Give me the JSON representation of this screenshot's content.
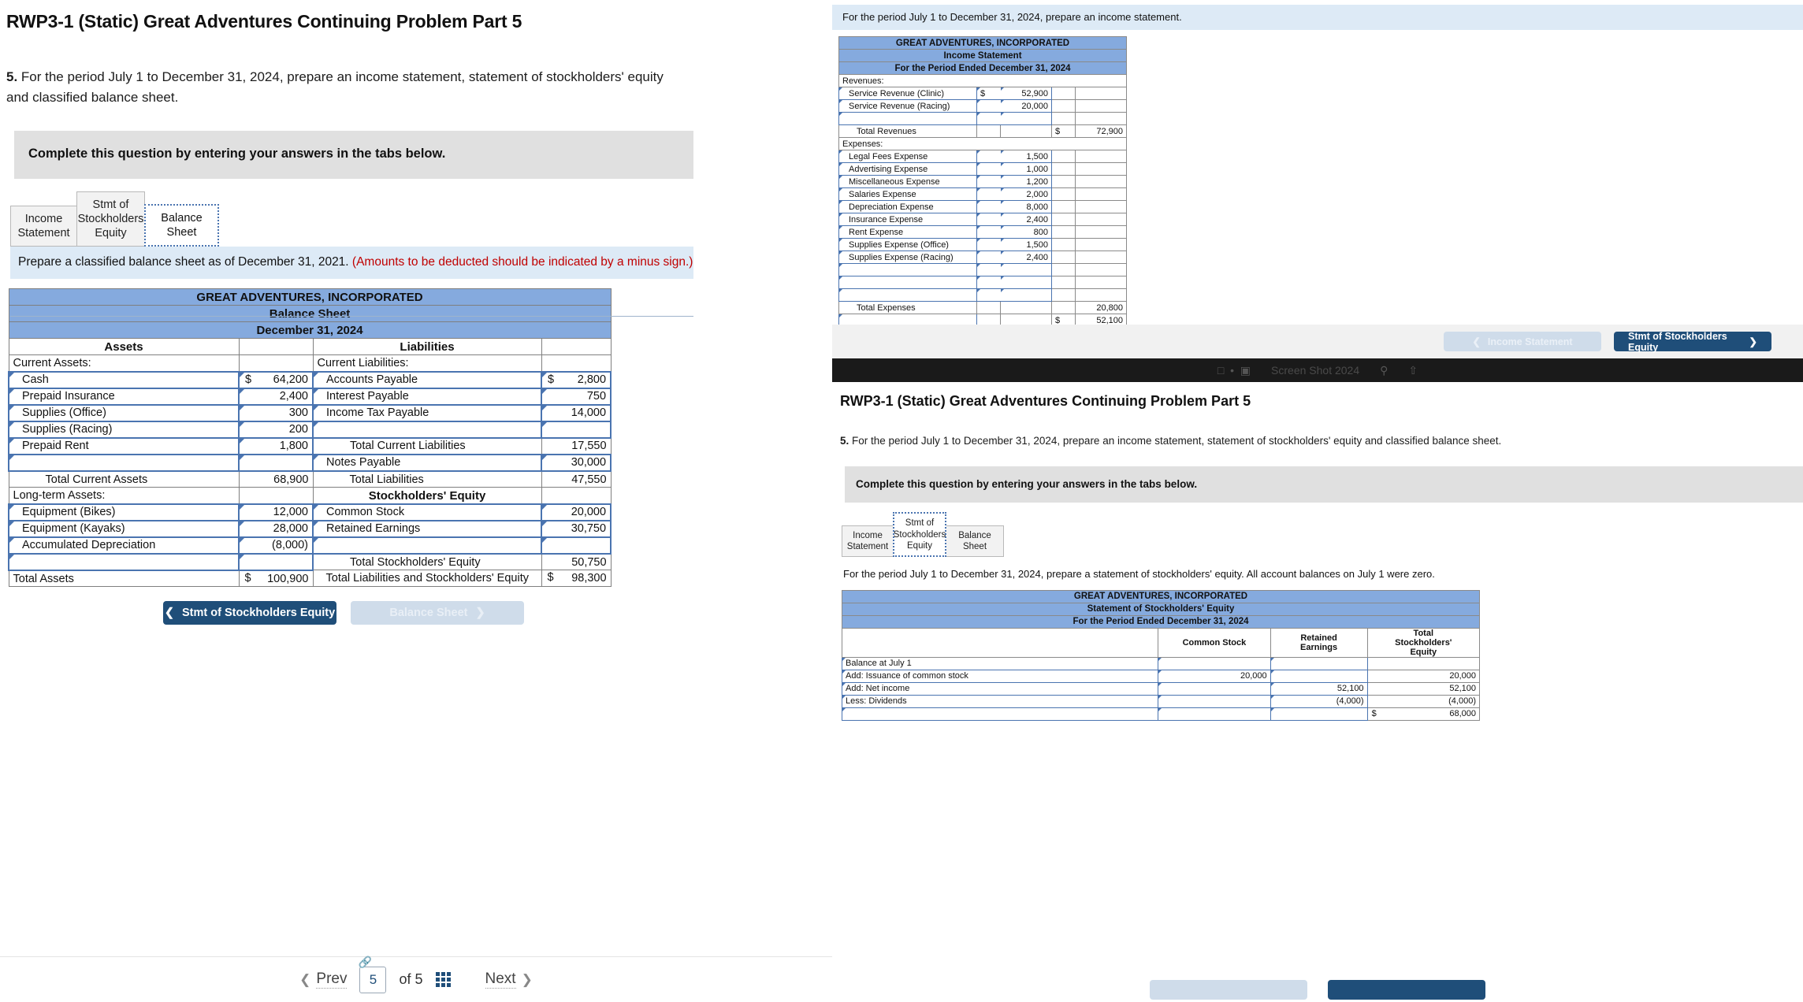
{
  "left": {
    "title": "RWP3-1 (Static) Great Adventures Continuing Problem Part 5",
    "question_number": "5.",
    "question_text": " For the period July 1 to December 31, 2024, prepare an income statement, statement of stockholders' equity and classified balance sheet.",
    "complete_bar": "Complete this question by entering your answers in the tabs below.",
    "tabs": [
      {
        "label": "Income\nStatement",
        "active": false
      },
      {
        "label": "Stmt of\nStockholders\nEquity",
        "active": false
      },
      {
        "label": "Balance Sheet",
        "active": true
      }
    ],
    "prepare_bar": {
      "text": "Prepare a classified balance sheet as of December 31, 2021. ",
      "note": "(Amounts to be deducted should be indicated by a minus sign.)"
    },
    "balance_sheet": {
      "company": "GREAT ADVENTURES, INCORPORATED",
      "statement": "Balance Sheet",
      "date": "December 31, 2024",
      "col_assets": "Assets",
      "col_liabilities": "Liabilities",
      "assets_header": "Current Assets:",
      "assets_rows": [
        {
          "label": "Cash",
          "dollar": "$",
          "amount": "64,200",
          "input": true,
          "indent": 1
        },
        {
          "label": "Prepaid Insurance",
          "dollar": "",
          "amount": "2,400",
          "input": true,
          "indent": 1
        },
        {
          "label": "Supplies (Office)",
          "dollar": "",
          "amount": "300",
          "input": true,
          "indent": 1
        },
        {
          "label": "Supplies (Racing)",
          "dollar": "",
          "amount": "200",
          "input": true,
          "indent": 1
        },
        {
          "label": "Prepaid Rent",
          "dollar": "",
          "amount": "1,800",
          "input": true,
          "indent": 1
        },
        {
          "label": "",
          "dollar": "",
          "amount": "",
          "input": true,
          "indent": 1
        }
      ],
      "total_current_assets": {
        "label": "Total Current Assets",
        "amount": "68,900"
      },
      "longterm_header": "Long-term Assets:",
      "longterm_rows": [
        {
          "label": "Equipment (Bikes)",
          "dollar": "",
          "amount": "12,000",
          "input": true,
          "indent": 1
        },
        {
          "label": "Equipment (Kayaks)",
          "dollar": "",
          "amount": "28,000",
          "input": true,
          "indent": 1
        },
        {
          "label": "Accumulated Depreciation",
          "dollar": "",
          "amount": "(8,000)",
          "input": true,
          "indent": 1
        },
        {
          "label": "",
          "dollar": "",
          "amount": "",
          "input": true,
          "indent": 1
        }
      ],
      "total_assets": {
        "label": "Total Assets",
        "dollar": "$",
        "amount": "100,900"
      },
      "liab_header": "Current Liabilities:",
      "liab_rows": [
        {
          "label": "Accounts Payable",
          "dollar": "$",
          "amount": "2,800",
          "input": true,
          "indent": 1
        },
        {
          "label": "Interest Payable",
          "dollar": "",
          "amount": "750",
          "input": true,
          "indent": 1
        },
        {
          "label": "Income Tax Payable",
          "dollar": "",
          "amount": "14,000",
          "input": true,
          "indent": 1
        },
        {
          "label": "",
          "dollar": "",
          "amount": "",
          "input": true,
          "indent": 1
        }
      ],
      "total_current_liabilities": {
        "label": "Total Current Liabilities",
        "amount": "17,550"
      },
      "notes_payable": {
        "label": "Notes Payable",
        "amount": "30,000",
        "input": true
      },
      "total_liabilities": {
        "label": "Total Liabilities",
        "amount": "47,550"
      },
      "equity_header": "Stockholders' Equity",
      "equity_rows": [
        {
          "label": "Common Stock",
          "amount": "20,000",
          "input": true
        },
        {
          "label": "Retained Earnings",
          "amount": "30,750",
          "input": true
        },
        {
          "label": "",
          "amount": "",
          "input": true
        }
      ],
      "total_equity": {
        "label": "Total Stockholders' Equity",
        "amount": "50,750"
      },
      "total_liab_equity": {
        "label": "Total Liabilities and Stockholders' Equity",
        "dollar": "$",
        "amount": "98,300"
      }
    },
    "nav": {
      "prev_label": "Stmt of Stockholders Equity",
      "next_label": "Balance Sheet"
    },
    "pager": {
      "prev": "Prev",
      "page": "5",
      "of": "of 5",
      "next": "Next"
    }
  },
  "right": {
    "shot_a": {
      "instruction": "For the period July 1 to December 31, 2024, prepare an income statement.",
      "income_statement": {
        "company": "GREAT ADVENTURES, INCORPORATED",
        "statement": "Income Statement",
        "period": "For the Period Ended December 31, 2024",
        "revenues_header": "Revenues:",
        "revenue_rows": [
          {
            "label": "Service Revenue (Clinic)",
            "dollar": "$",
            "amount": "52,900"
          },
          {
            "label": "Service Revenue (Racing)",
            "dollar": "",
            "amount": "20,000"
          },
          {
            "label": "",
            "dollar": "",
            "amount": ""
          },
          {
            "label": "",
            "dollar": "",
            "amount": ""
          }
        ],
        "total_revenues": {
          "label": "Total Revenues",
          "dollar": "$",
          "amount": "72,900"
        },
        "expenses_header": "Expenses:",
        "expense_rows": [
          {
            "label": "Legal Fees Expense",
            "amount": "1,500"
          },
          {
            "label": "Advertising Expense",
            "amount": "1,000"
          },
          {
            "label": "Miscellaneous Expense",
            "amount": "1,200"
          },
          {
            "label": "Salaries Expense",
            "amount": "2,000"
          },
          {
            "label": "Depreciation Expense",
            "amount": "8,000"
          },
          {
            "label": "Insurance Expense",
            "amount": "2,400"
          },
          {
            "label": "Rent Expense",
            "amount": "800"
          },
          {
            "label": "Supplies Expense (Office)",
            "amount": "1,500"
          },
          {
            "label": "Supplies Expense (Racing)",
            "amount": "2,400"
          },
          {
            "label": "",
            "amount": ""
          },
          {
            "label": "",
            "amount": ""
          },
          {
            "label": "",
            "amount": ""
          },
          {
            "label": "",
            "amount": ""
          }
        ],
        "total_expenses": {
          "label": "Total Expenses",
          "amount": "20,800"
        },
        "net_income": {
          "label": "",
          "dollar": "$",
          "amount": "52,100"
        }
      },
      "nav": {
        "prev_label": "Income Statement",
        "next_label": "Stmt of Stockholders Equity"
      }
    },
    "os_band": {
      "text": "Screen Shot 2024"
    },
    "shot_b": {
      "title": "RWP3-1 (Static) Great Adventures Continuing Problem Part 5",
      "question_number": "5.",
      "question_text": " For the period July 1 to December 31, 2024, prepare an income statement, statement of stockholders' equity and classified balance sheet.",
      "complete_bar": "Complete this question by entering your answers in the tabs below.",
      "tabs": [
        {
          "label": "Income\nStatement",
          "active": false
        },
        {
          "label": "Stmt of\nStockholders\nEquity",
          "active": true
        },
        {
          "label": "Balance Sheet",
          "active": false
        }
      ],
      "instruction": "For the period July 1 to December 31, 2024, prepare a statement of stockholders' equity. All account balances on July 1 were zero.",
      "equity_statement": {
        "company": "GREAT ADVENTURES, INCORPORATED",
        "statement": "Statement of Stockholders' Equity",
        "period": "For the Period Ended December 31, 2024",
        "columns": [
          "",
          "Common Stock",
          "Retained\nEarnings",
          "Total\nStockholders'\nEquity"
        ],
        "rows": [
          {
            "label": "Balance at July 1",
            "common": "",
            "retained": "",
            "total": ""
          },
          {
            "label": "Add: Issuance of common stock",
            "common": "20,000",
            "retained": "",
            "total": "20,000"
          },
          {
            "label": "Add: Net income",
            "common": "",
            "retained": "52,100",
            "total": "52,100"
          },
          {
            "label": "Less: Dividends",
            "common": "",
            "retained": "(4,000)",
            "total": "(4,000)"
          },
          {
            "label": "",
            "common": "",
            "retained": "",
            "total_dollar": "$",
            "total": "68,000"
          }
        ]
      }
    }
  }
}
